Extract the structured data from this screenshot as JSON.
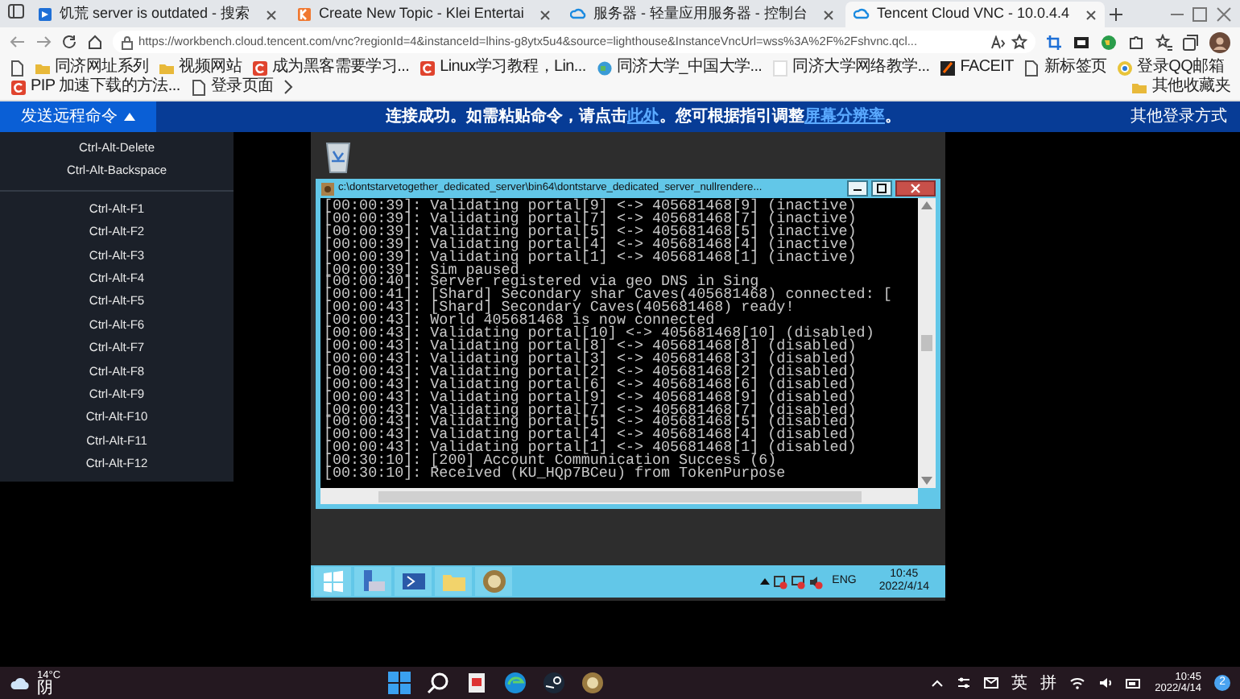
{
  "browser": {
    "tabs": [
      {
        "title": "饥荒 server is outdated - 搜索",
        "kind": "search",
        "selected": false
      },
      {
        "title": "Create New Topic - Klei Entertai",
        "kind": "klei",
        "selected": false
      },
      {
        "title": "服务器 - 轻量应用服务器 - 控制台",
        "kind": "cloud",
        "selected": false
      },
      {
        "title": "Tencent Cloud VNC - 10.0.4.4",
        "kind": "cloud",
        "selected": true
      }
    ],
    "url": "https://workbench.cloud.tencent.com/vnc?regionId=4&instanceId=lhins-g8ytx5u4&source=lighthouse&InstanceVncUrl=wss%3A%2F%2Fshvnc.qcl...",
    "bookmarks": [
      {
        "label": "同济网址系列",
        "kind": "folder"
      },
      {
        "label": "视频网站",
        "kind": "folder"
      },
      {
        "label": "成为黑客需要学习...",
        "kind": "red"
      },
      {
        "label": "Linux学习教程，Lin...",
        "kind": "red"
      },
      {
        "label": "同济大学_中国大学...",
        "kind": "globe"
      },
      {
        "label": "同济大学网络教学...",
        "kind": "blank"
      },
      {
        "label": "FACEIT",
        "kind": "dark"
      },
      {
        "label": "新标签页",
        "kind": "page"
      },
      {
        "label": "登录QQ邮箱",
        "kind": "chrome"
      },
      {
        "label": "PIP 加速下载的方法...",
        "kind": "red"
      },
      {
        "label": "登录页面",
        "kind": "page"
      }
    ],
    "other_bookmarks": "其他收藏夹"
  },
  "vnc": {
    "command_button": "发送远程命令",
    "notice": [
      {
        "text": "连接成功。如需粘贴命令，请点击",
        "link": false
      },
      {
        "text": "此处",
        "link": true
      },
      {
        "text": "。您可根据指引调整",
        "link": false
      },
      {
        "text": "屏幕分辨率",
        "link": true
      },
      {
        "text": "。",
        "link": false
      }
    ],
    "alt_login": "其他登录方式",
    "menu": [
      [
        "Ctrl-Alt-Delete",
        "Ctrl-Alt-Backspace"
      ],
      [
        "Ctrl-Alt-F1",
        "Ctrl-Alt-F2",
        "Ctrl-Alt-F3",
        "Ctrl-Alt-F4",
        "Ctrl-Alt-F5",
        "Ctrl-Alt-F6",
        "Ctrl-Alt-F7",
        "Ctrl-Alt-F8",
        "Ctrl-Alt-F9",
        "Ctrl-Alt-F10",
        "Ctrl-Alt-F11",
        "Ctrl-Alt-F12"
      ]
    ]
  },
  "remote": {
    "console": {
      "title": "c:\\dontstarvetogether_dedicated_server\\bin64\\dontstarve_dedicated_server_nullrendere...",
      "lines": [
        "[00:00:39]: Validating portal[9] <-> 405681468[9] (inactive)",
        "[00:00:39]: Validating portal[7] <-> 405681468[7] (inactive)",
        "[00:00:39]: Validating portal[5] <-> 405681468[5] (inactive)",
        "[00:00:39]: Validating portal[4] <-> 405681468[4] (inactive)",
        "[00:00:39]: Validating portal[1] <-> 405681468[1] (inactive)",
        "[00:00:39]: Sim paused",
        "[00:00:40]: Server registered via geo DNS in Sing",
        "[00:00:41]: [Shard] Secondary shar Caves(405681468) connected: [",
        "[00:00:43]: [Shard] Secondary Caves(405681468) ready!",
        "[00:00:43]: World 405681468 is now connected",
        "[00:00:43]: Validating portal[10] <-> 405681468[10] (disabled)",
        "[00:00:43]: Validating portal[8] <-> 405681468[8] (disabled)",
        "[00:00:43]: Validating portal[3] <-> 405681468[3] (disabled)",
        "[00:00:43]: Validating portal[2] <-> 405681468[2] (disabled)",
        "[00:00:43]: Validating portal[6] <-> 405681468[6] (disabled)",
        "[00:00:43]: Validating portal[9] <-> 405681468[9] (disabled)",
        "[00:00:43]: Validating portal[7] <-> 405681468[7] (disabled)",
        "[00:00:43]: Validating portal[5] <-> 405681468[5] (disabled)",
        "[00:00:43]: Validating portal[4] <-> 405681468[4] (disabled)",
        "[00:00:43]: Validating portal[1] <-> 405681468[1] (disabled)",
        "[00:30:10]: [200] Account Communication Success (6)",
        "[00:30:10]: Received (KU_HQp7BCeu) from TokenPurpose"
      ]
    },
    "taskbar": {
      "language": "ENG",
      "time": "10:45",
      "date": "2022/4/14"
    }
  },
  "taskbar": {
    "weather": {
      "temperature": "14°C",
      "condition": "阴"
    },
    "ime": [
      "英",
      "拼"
    ],
    "time": "10:45",
    "date": "2022/4/14",
    "notifications": "2"
  }
}
